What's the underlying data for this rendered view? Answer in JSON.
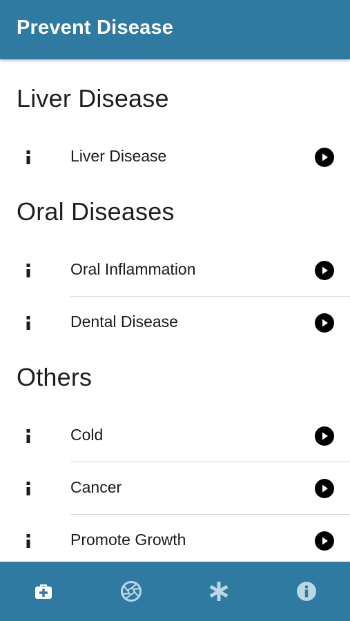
{
  "app_bar": {
    "title": "Prevent Disease"
  },
  "sections": [
    {
      "title": "Liver Disease",
      "items": [
        {
          "label": "Liver Disease"
        }
      ]
    },
    {
      "title": "Oral Diseases",
      "items": [
        {
          "label": "Oral Inflammation"
        },
        {
          "label": "Dental Disease"
        }
      ]
    },
    {
      "title": "Others",
      "items": [
        {
          "label": "Cold"
        },
        {
          "label": "Cancer"
        },
        {
          "label": "Promote Growth"
        }
      ]
    }
  ],
  "tab_bar": {
    "tabs": [
      {
        "icon": "first-aid-kit-icon",
        "active": true
      },
      {
        "icon": "aperture-icon",
        "active": false
      },
      {
        "icon": "asterisk-icon",
        "active": false
      },
      {
        "icon": "info-circle-icon",
        "active": false
      }
    ]
  },
  "colors": {
    "primary": "#2e7aa1",
    "tab_active": "#ffffff",
    "tab_inactive": "#b9d7e6",
    "text": "#1a1a1a",
    "divider": "#d6d6d6"
  }
}
